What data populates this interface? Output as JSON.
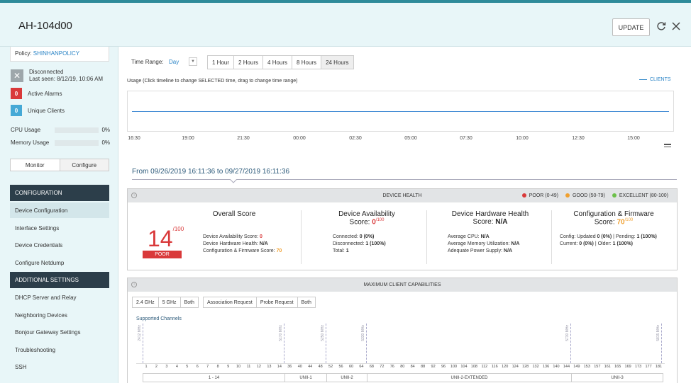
{
  "header": {
    "title": "AH-104d00",
    "update_label": "UPDATE",
    "refresh_icon": "refresh-icon",
    "close_icon": "close-icon"
  },
  "sidebar": {
    "policy_prefix": "Policy:",
    "policy_name": "SHINHANPOLICY",
    "status": "Disconnected",
    "last_seen": "Last seen: 8/12/19, 10:06 AM",
    "active_alarms_count": "0",
    "active_alarms_label": "Active Alarms",
    "unique_clients_count": "0",
    "unique_clients_label": "Unique Clients",
    "cpu_label": "CPU Usage",
    "cpu_value": "0%",
    "memory_label": "Memory Usage",
    "memory_value": "0%",
    "tab_monitor": "Monitor",
    "tab_configure": "Configure",
    "section_configuration": "CONFIGURATION",
    "config_items": [
      "Device Configuration",
      "Interface Settings",
      "Device Credentials",
      "Configure Netdump"
    ],
    "section_additional": "ADDITIONAL SETTINGS",
    "additional_items": [
      "DHCP Server and Relay",
      "Neighboring Devices",
      "Bonjour Gateway Settings",
      "Troubleshooting",
      "SSH"
    ]
  },
  "timerange": {
    "label": "Time Range:",
    "selected": "Day",
    "options": [
      "1 Hour",
      "2 Hours",
      "4 Hours",
      "8 Hours",
      "24 Hours"
    ]
  },
  "usage": {
    "label": "Usage (Click timeline to change SELECTED time, drag to change time range)",
    "legend": "CLIENTS",
    "ticks": [
      "16:30",
      "19:00",
      "21:30",
      "00:00",
      "02:30",
      "05:00",
      "07:30",
      "10:00",
      "12:30",
      "15:00"
    ]
  },
  "range_text": {
    "from_label": "From",
    "from": "09/26/2019 16:11:36",
    "to_label": "to",
    "to": "09/27/2019 16:11:36"
  },
  "device_health": {
    "title": "DEVICE HEALTH",
    "legend": [
      {
        "label": "POOR (0-49)",
        "color": "#d9393a"
      },
      {
        "label": "GOOD (50-79)",
        "color": "#f0a030"
      },
      {
        "label": "EXCELLENT (80-100)",
        "color": "#6cc04a"
      }
    ],
    "overall": {
      "title": "Overall Score",
      "score": "14",
      "max": "/100",
      "badge": "POOR",
      "lines": [
        {
          "label": "Device Availability Score:",
          "value": "0"
        },
        {
          "label": "Device Hardware Health:",
          "value": "N/A"
        },
        {
          "label": "Configuration & Firmware Score:",
          "value": "70"
        }
      ]
    },
    "availability": {
      "title": "Device Availability",
      "score_label": "Score:",
      "score": "0",
      "max": "/100",
      "lines": [
        {
          "label": "Connected:",
          "value": "0 (0%)"
        },
        {
          "label": "Disconnected:",
          "value": "1 (100%)"
        },
        {
          "label": "Total:",
          "value": "1"
        }
      ]
    },
    "hardware": {
      "title": "Device Hardware Health",
      "score_label": "Score:",
      "score": "N/A",
      "lines": [
        {
          "label": "Average CPU:",
          "value": "N/A"
        },
        {
          "label": "Average Memory Utilization:",
          "value": "N/A"
        },
        {
          "label": "Adequate Power Supply:",
          "value": "N/A"
        }
      ]
    },
    "config_fw": {
      "title": "Configuration & Firmware",
      "score_label": "Score:",
      "score": "70",
      "max": "/100",
      "line1": "Config: Updated",
      "line1_v1": "0 (0%)",
      "line1_mid": "| Pending:",
      "line1_v2": "1 (100%)",
      "line2": "Current:",
      "line2_v1": "0 (0%)",
      "line2_mid": "| Older:",
      "line2_v2": "1 (100%)"
    }
  },
  "client_caps": {
    "title": "MAXIMUM CLIENT CAPABILITIES",
    "band_buttons": [
      "2.4 GHz",
      "5 GHz",
      "Both"
    ],
    "request_buttons": [
      "Association Request",
      "Probe Request",
      "Both"
    ],
    "supported_label": "Supported Channels",
    "freq_marks": [
      "2412 MHz",
      "5170 MHz",
      "5250 MHz",
      "5330 MHz",
      "5730 MHz",
      "5815 MHz"
    ],
    "channels": [
      "1",
      "2",
      "3",
      "4",
      "5",
      "6",
      "7",
      "8",
      "9",
      "10",
      "11",
      "12",
      "13",
      "14",
      "36",
      "40",
      "44",
      "48",
      "52",
      "56",
      "60",
      "64",
      "68",
      "72",
      "76",
      "80",
      "84",
      "88",
      "92",
      "96",
      "100",
      "104",
      "108",
      "112",
      "116",
      "120",
      "124",
      "128",
      "132",
      "136",
      "140",
      "144",
      "149",
      "153",
      "157",
      "161",
      "165",
      "169",
      "173",
      "177",
      "181"
    ],
    "bands": [
      "1 - 14",
      "UNII-1",
      "UNII-2",
      "UNII-2-EXTENDED",
      "UNII-3"
    ]
  }
}
